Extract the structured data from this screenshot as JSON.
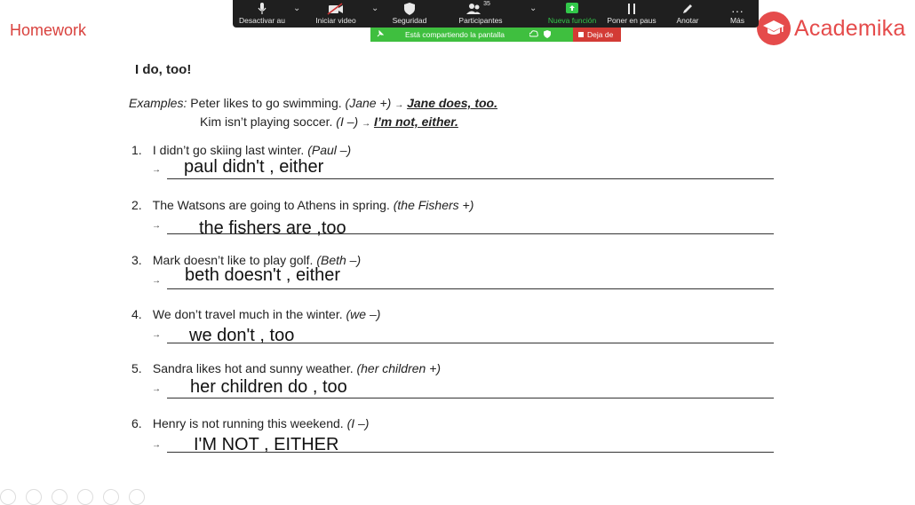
{
  "header": {
    "homework": "Homework",
    "brand": "Academika"
  },
  "toolbar": {
    "tools": [
      {
        "label": "Desactivar au",
        "icon": "microphone-icon"
      },
      {
        "label": "Iniciar video",
        "icon": "video-off-icon"
      },
      {
        "label": "Seguridad",
        "icon": "shield-icon"
      },
      {
        "label": "Participantes",
        "icon": "participants-icon",
        "badge": "35"
      },
      {
        "label": "Nueva función",
        "icon": "share-screen-icon"
      },
      {
        "label": "Poner en paus",
        "icon": "pause-icon"
      },
      {
        "label": "Anotar",
        "icon": "pencil-icon"
      },
      {
        "label": "Más",
        "icon": "more-icon"
      }
    ],
    "share_text": "Está compartiendo la pantalla",
    "stop_label": "Deja de"
  },
  "worksheet": {
    "title": "I do, too!",
    "examples_label": "Examples:",
    "example1": {
      "text": "Peter likes to go swimming.",
      "hint": "(Jane +)",
      "answer": "Jane does, too."
    },
    "example2": {
      "text": "Kim isn’t playing soccer.",
      "hint": "(I –)",
      "answer": "I’m not, either."
    },
    "questions": [
      {
        "num": "1.",
        "text": "I didn’t go skiing last winter.",
        "hint": "(Paul –)",
        "answer": "paul didn't , either"
      },
      {
        "num": "2.",
        "text": "The Watsons are going to Athens in spring.",
        "hint": "(the Fishers +)",
        "answer": "the fishers are ,too"
      },
      {
        "num": "3.",
        "text": "Mark doesn’t like to play golf.",
        "hint": "(Beth –)",
        "answer": "beth doesn't , either"
      },
      {
        "num": "4.",
        "text": "We don’t travel much in the winter.",
        "hint": "(we –)",
        "answer": "we don't , too"
      },
      {
        "num": "5.",
        "text": "Sandra likes hot and sunny weather.",
        "hint": "(her children +)",
        "answer": "her children do , too"
      },
      {
        "num": "6.",
        "text": "Henry is not running this weekend.",
        "hint": "(I –)",
        "answer": "I'M NOT , EITHER"
      }
    ]
  },
  "colors": {
    "accent": "#e54b4b",
    "homework": "#d9423e",
    "toolbar": "#1f1f1f",
    "share": "#3fbf3f",
    "stop": "#d33b35",
    "green_label": "#32c84a"
  }
}
